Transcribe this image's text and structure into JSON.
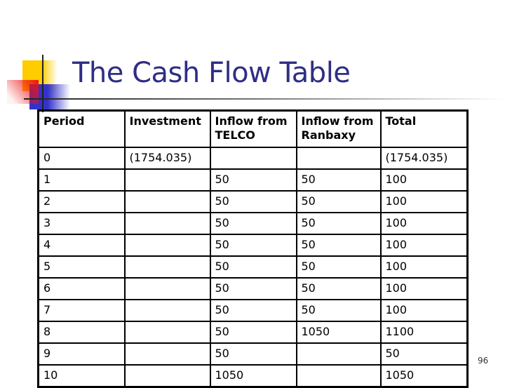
{
  "slide": {
    "title": "The Cash Flow Table",
    "page_number": "96",
    "colors": {
      "title": "#2e2e86",
      "accent_yellow": "#ffcc00",
      "accent_red": "#ee2222",
      "accent_blue": "#3333cc"
    }
  },
  "table": {
    "headers": [
      "Period",
      "Investment",
      "Inflow from TELCO",
      "Inflow from Ranbaxy",
      "Total"
    ],
    "rows": [
      [
        "0",
        "(1754.035)",
        "",
        "",
        "(1754.035)"
      ],
      [
        "1",
        "",
        "50",
        "50",
        "100"
      ],
      [
        "2",
        "",
        "50",
        "50",
        "100"
      ],
      [
        "3",
        "",
        "50",
        "50",
        "100"
      ],
      [
        "4",
        "",
        "50",
        "50",
        "100"
      ],
      [
        "5",
        "",
        "50",
        "50",
        "100"
      ],
      [
        "6",
        "",
        "50",
        "50",
        "100"
      ],
      [
        "7",
        "",
        "50",
        "50",
        "100"
      ],
      [
        "8",
        "",
        "50",
        "1050",
        "1100"
      ],
      [
        "9",
        "",
        "50",
        "",
        "50"
      ],
      [
        "10",
        "",
        "1050",
        "",
        "1050"
      ]
    ]
  }
}
